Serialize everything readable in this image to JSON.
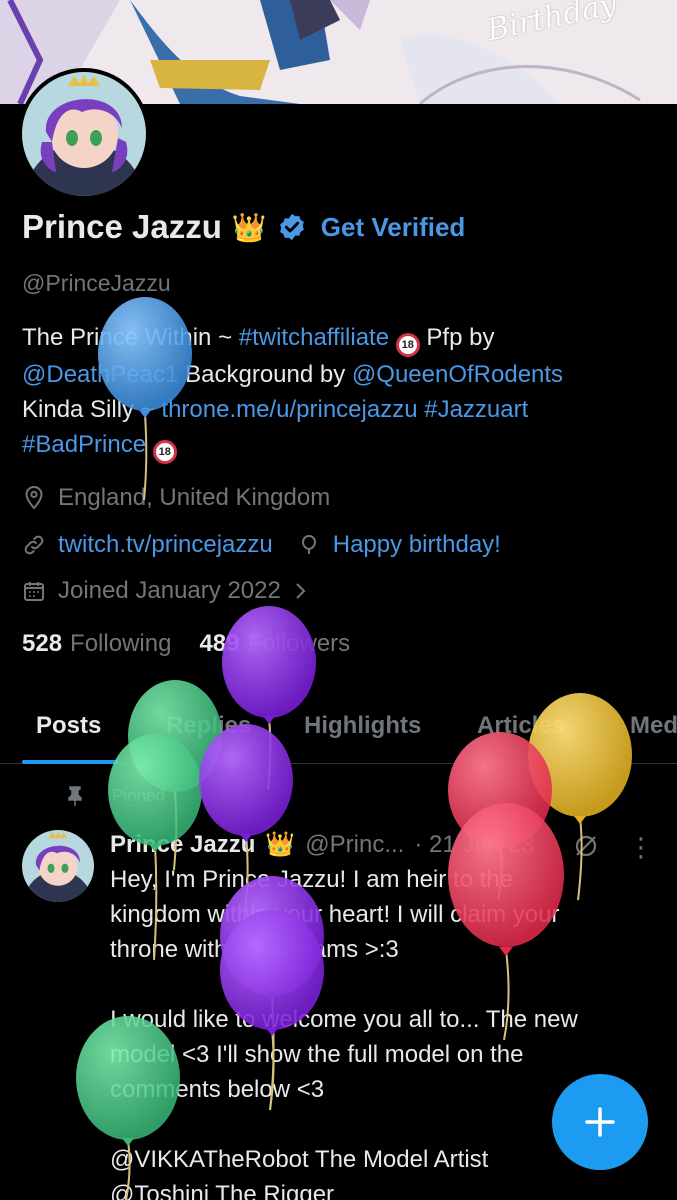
{
  "profile": {
    "banner_text": "Birthday",
    "display_name": "Prince Jazzu",
    "name_emoji": "👑",
    "get_verified": "Get Verified",
    "handle": "@PrinceJazzu",
    "bio": {
      "line1_a": "The Prince Within ~ ",
      "line1_link": "#twitchaffiliate",
      "line1_b": " Pfp by",
      "line2_link1": "@DeathPeac1",
      "line2_b": " Background by ",
      "line2_link2": "@QueenOfRodents",
      "line3_a": "Kinda Silly ~ ",
      "line3_link1": "throne.me/u/princejazzu",
      "line3_link2": "#Jazzuart",
      "line4_link": "#BadPrince",
      "adult_badge": "18"
    },
    "location": "England, United Kingdom",
    "website": "twitch.tv/princejazzu",
    "birthday": "Happy birthday!",
    "joined": "Joined January 2022",
    "following_count": "528",
    "following_label": "Following",
    "followers_count": "489",
    "followers_label": "Followers"
  },
  "tabs": [
    {
      "label": "Posts",
      "active": true
    },
    {
      "label": "Replies"
    },
    {
      "label": "Highlights"
    },
    {
      "label": "Articles"
    },
    {
      "label": "Media"
    }
  ],
  "pinned": {
    "label": "Pinned",
    "author_name": "Prince Jazzu",
    "author_emoji": "👑",
    "author_handle": "@Princ...",
    "date": "· 21 Jan 23",
    "more": "⋮",
    "text_line1": "Hey, I'm Prince Jazzu! I am heir to the",
    "text_line2": "kingdom within your heart! I will claim your",
    "text_line3": "throne with my streams >:3",
    "text_line4": "I would like to welcome you all to... The new",
    "text_line5": "model <3 I'll show the full model on the",
    "text_line6": "comments below <3",
    "text_line7": "@VIKKATheRobot The Model Artist",
    "text_line8": "@Toshini The Rigger"
  },
  "fab": {
    "icon": "plus-icon"
  },
  "colors": {
    "accent": "#1d9bf0",
    "link": "#4a98e6",
    "background": "#000000",
    "muted": "#71767b"
  }
}
